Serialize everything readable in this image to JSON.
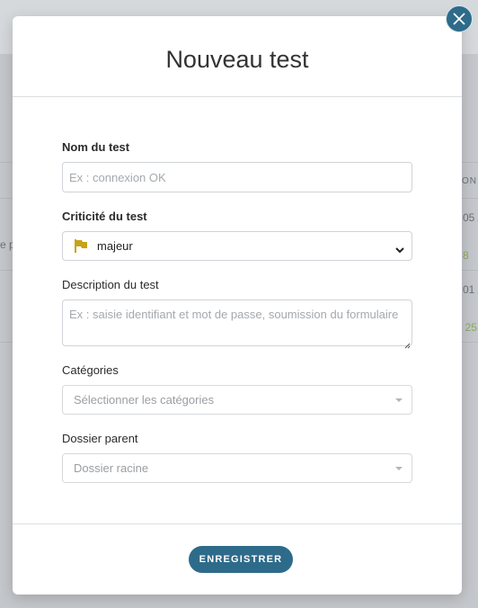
{
  "background": {
    "header_fragment": "ON",
    "row1_date": "05 /",
    "row1_text": "e p",
    "row1_status": "8",
    "row2_date": "01 /",
    "row2_status": "' 25"
  },
  "modal": {
    "title": "Nouveau test",
    "name_label": "Nom du test",
    "name_placeholder": "Ex : connexion OK",
    "criticality_label": "Criticité du test",
    "criticality_value": "majeur",
    "criticality_icon": "flag-icon",
    "criticality_color": "#c9a21a",
    "description_label": "Description du test",
    "description_placeholder": "Ex : saisie identifiant et mot de passe, soumission du formulaire",
    "categories_label": "Catégories",
    "categories_placeholder": "Sélectionner les catégories",
    "parent_label": "Dossier parent",
    "parent_value": "Dossier racine",
    "save_label": "ENREGISTRER",
    "close_icon": "close-icon"
  },
  "colors": {
    "accent": "#2e6b8a"
  }
}
